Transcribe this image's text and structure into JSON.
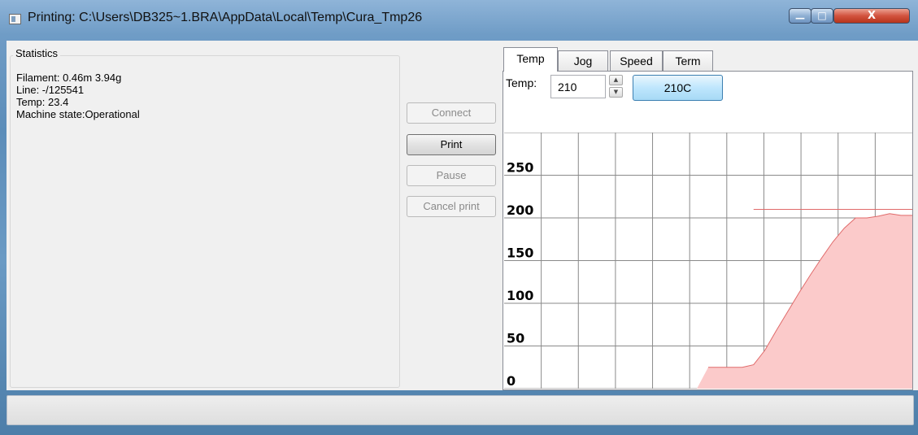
{
  "window": {
    "title": "Printing: C:\\Users\\DB325~1.BRA\\AppData\\Local\\Temp\\Cura_Tmp26",
    "controls": {
      "minimize": "—",
      "maximize": "□",
      "close": "X"
    }
  },
  "statistics": {
    "title": "Statistics",
    "filament": "Filament: 0.46m 3.94g",
    "line": "Line: -/125541",
    "temp": "Temp: 23.4",
    "machine_state": "Machine state:Operational"
  },
  "buttons": {
    "connect": "Connect",
    "print": "Print",
    "pause": "Pause",
    "cancel_print": "Cancel print"
  },
  "tabs": [
    "Temp",
    "Jog",
    "Speed",
    "Term"
  ],
  "temp_panel": {
    "label": "Temp:",
    "value": "210",
    "set_button": "210C"
  },
  "chart_data": {
    "type": "area",
    "y_tick_labels": [
      "250",
      "200",
      "150",
      "100",
      "50",
      "0"
    ],
    "ylim": [
      0,
      300
    ],
    "grid": true,
    "target_line": 210,
    "series": [
      {
        "x": [
          0,
          1,
          2,
          3,
          4,
          5,
          6,
          7,
          8,
          9,
          10,
          11,
          12,
          13,
          14,
          15,
          16,
          17,
          18,
          19,
          20,
          21,
          22,
          23,
          24,
          25,
          26,
          27,
          28,
          29,
          30,
          31,
          32,
          33,
          34,
          35,
          36
        ],
        "values": [
          0,
          0,
          0,
          0,
          0,
          0,
          0,
          0,
          0,
          0,
          0,
          0,
          0,
          0,
          0,
          0,
          0,
          0,
          25,
          25,
          25,
          25,
          28,
          45,
          68,
          90,
          112,
          133,
          153,
          172,
          188,
          200,
          200,
          202,
          205,
          203,
          203
        ]
      }
    ],
    "colors": {
      "fill": "#fbcaca",
      "line": "#e06a6a"
    }
  }
}
